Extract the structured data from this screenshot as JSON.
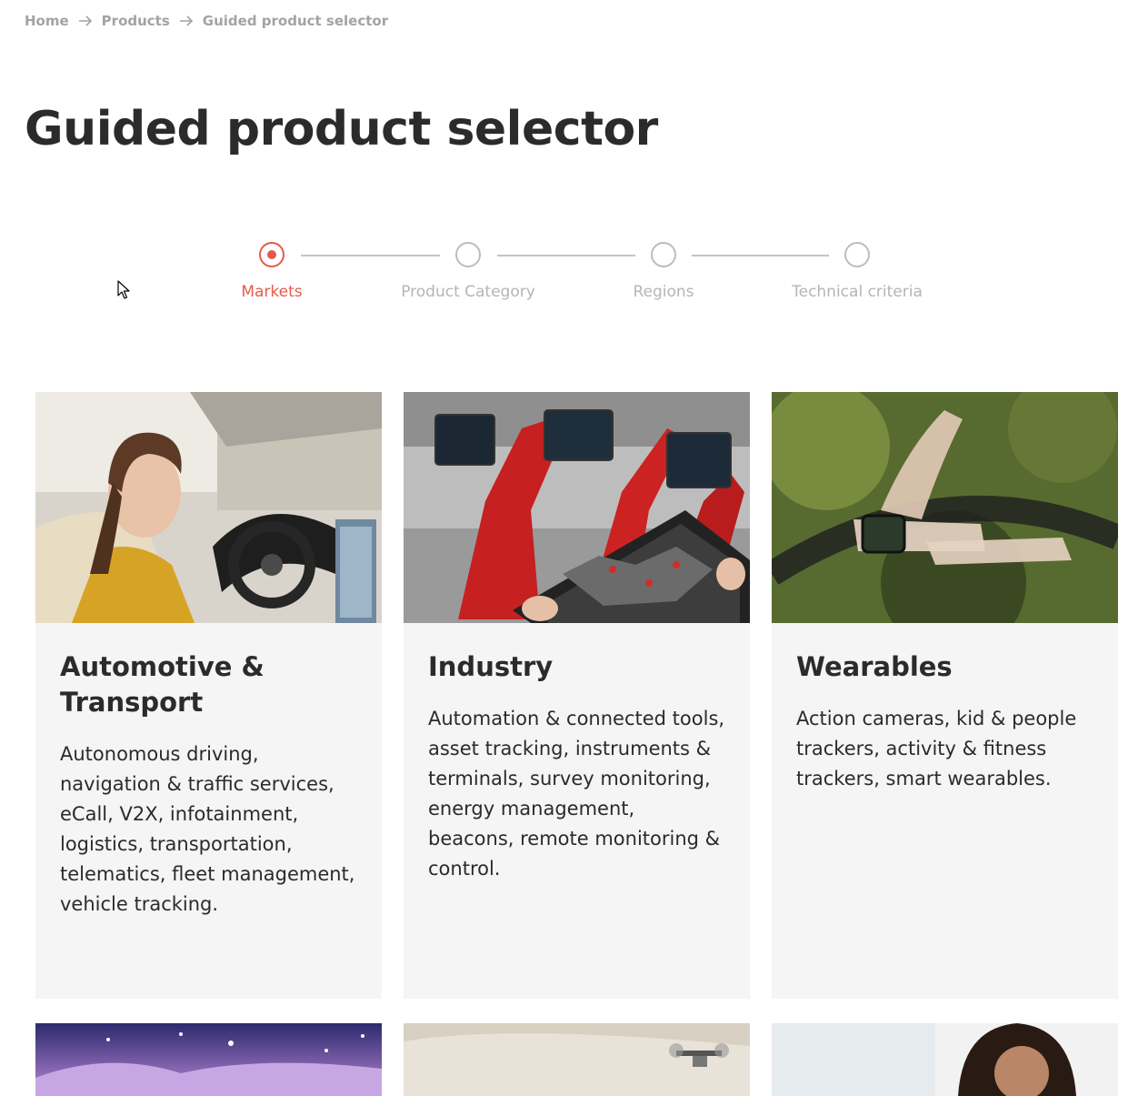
{
  "breadcrumb": {
    "items": [
      "Home",
      "Products",
      "Guided product selector"
    ]
  },
  "page": {
    "title": "Guided product selector"
  },
  "stepper": {
    "steps": [
      {
        "label": "Markets",
        "active": true
      },
      {
        "label": "Product Category",
        "active": false
      },
      {
        "label": "Regions",
        "active": false
      },
      {
        "label": "Technical criteria",
        "active": false
      }
    ],
    "accent_color": "#e8594a",
    "inactive_color": "#bdbdbd"
  },
  "cards": [
    {
      "title": "Automotive & Transport",
      "description": "Autonomous driving, navigation & traffic services, eCall, V2X, infotainment, logistics, transportation, telematics, fleet management, vehicle tracking.",
      "image": "woman-driving-car-photo"
    },
    {
      "title": "Industry",
      "description": "Automation & connected tools, asset tracking, instruments & terminals, survey monitoring, energy management, beacons, remote monitoring & control.",
      "image": "industrial-robots-tablet-photo"
    },
    {
      "title": "Wearables",
      "description": "Action cameras, kid & people trackers, activity & fitness trackers, smart wearables.",
      "image": "smartwatch-steering-wheel-photo"
    },
    {
      "image": "starry-sky-photo"
    },
    {
      "image": "drone-landscape-photo"
    },
    {
      "image": "woman-portrait-photo"
    }
  ]
}
